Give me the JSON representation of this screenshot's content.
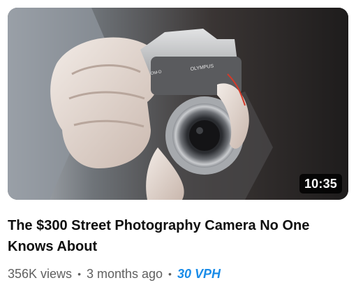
{
  "video": {
    "duration": "10:35",
    "title": "The $300 Street Photography Camera No One Knows About",
    "views": "356K views",
    "separator": "•",
    "age": "3 months ago",
    "vph": "30 VPH"
  },
  "thumbnail": {
    "camera_brand": "OLYMPUS",
    "camera_model_text": "OM-D",
    "depicts": "hands-holding-camera"
  },
  "colors": {
    "vph_accent": "#1a8ce8",
    "duration_badge_bg": "#000000",
    "title_text": "#0f0f0f",
    "meta_text": "#606060"
  }
}
